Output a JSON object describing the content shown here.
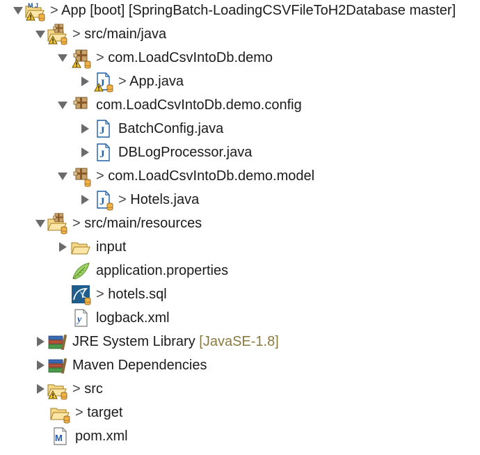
{
  "package_explorer": {
    "rows": [
      {
        "name": "project-app",
        "expanded": true,
        "icon": "maven-project-warning-icon",
        "dirty": true,
        "label": "App [boot] [SpringBatch-LoadingCSVFileToH2Database master]",
        "extra": ""
      },
      {
        "name": "src-main-java",
        "expanded": true,
        "icon": "source-folder-warning-icon",
        "dirty": true,
        "label": "src/main/java",
        "extra": ""
      },
      {
        "name": "package-demo",
        "expanded": true,
        "icon": "package-warning-icon",
        "dirty": true,
        "label": "com.LoadCsvIntoDb.demo",
        "extra": ""
      },
      {
        "name": "file-app-java",
        "expanded": false,
        "icon": "java-file-warning-icon",
        "dirty": true,
        "label": "App.java",
        "extra": ""
      },
      {
        "name": "package-demo-config",
        "expanded": true,
        "icon": "package-icon",
        "dirty": false,
        "label": "com.LoadCsvIntoDb.demo.config",
        "extra": ""
      },
      {
        "name": "file-batchconfig-java",
        "expanded": false,
        "icon": "java-file-icon",
        "dirty": false,
        "label": "BatchConfig.java",
        "extra": ""
      },
      {
        "name": "file-dblogprocessor-java",
        "expanded": false,
        "icon": "java-file-icon",
        "dirty": false,
        "label": "DBLogProcessor.java",
        "extra": ""
      },
      {
        "name": "package-demo-model",
        "expanded": true,
        "icon": "package-icon",
        "dirty": true,
        "label": "com.LoadCsvIntoDb.demo.model",
        "extra": ""
      },
      {
        "name": "file-hotels-java",
        "expanded": false,
        "icon": "java-file-icon",
        "dirty": true,
        "label": "Hotels.java",
        "extra": ""
      },
      {
        "name": "src-main-resources",
        "expanded": true,
        "icon": "source-folder-icon",
        "dirty": true,
        "label": "src/main/resources",
        "extra": ""
      },
      {
        "name": "folder-input",
        "expanded": false,
        "icon": "folder-icon",
        "dirty": false,
        "label": "input",
        "extra": ""
      },
      {
        "name": "file-application-properties",
        "expanded": null,
        "icon": "properties-file-icon",
        "dirty": false,
        "label": "application.properties",
        "extra": ""
      },
      {
        "name": "file-hotels-sql",
        "expanded": null,
        "icon": "sql-file-icon",
        "dirty": true,
        "label": "hotels.sql",
        "extra": ""
      },
      {
        "name": "file-logback-xml",
        "expanded": null,
        "icon": "xml-file-icon",
        "dirty": false,
        "label": "logback.xml",
        "extra": ""
      },
      {
        "name": "jre-system-library",
        "expanded": false,
        "icon": "library-icon",
        "dirty": false,
        "label": "JRE System Library",
        "extra": "[JavaSE-1.8]"
      },
      {
        "name": "maven-dependencies",
        "expanded": false,
        "icon": "library-icon",
        "dirty": false,
        "label": "Maven Dependencies",
        "extra": ""
      },
      {
        "name": "folder-src",
        "expanded": false,
        "icon": "folder-warning-icon",
        "dirty": true,
        "label": "src",
        "extra": ""
      },
      {
        "name": "folder-target",
        "expanded": null,
        "icon": "folder-icon",
        "dirty": true,
        "label": "target",
        "extra": ""
      },
      {
        "name": "file-pom-xml",
        "expanded": null,
        "icon": "maven-pom-icon",
        "dirty": false,
        "label": "pom.xml",
        "extra": ""
      }
    ],
    "dirty_prefix": "> ",
    "colors": {
      "text": "#1b1b1b",
      "extra_text": "#8a7a3e",
      "twisty": "#6b6b6b"
    }
  }
}
